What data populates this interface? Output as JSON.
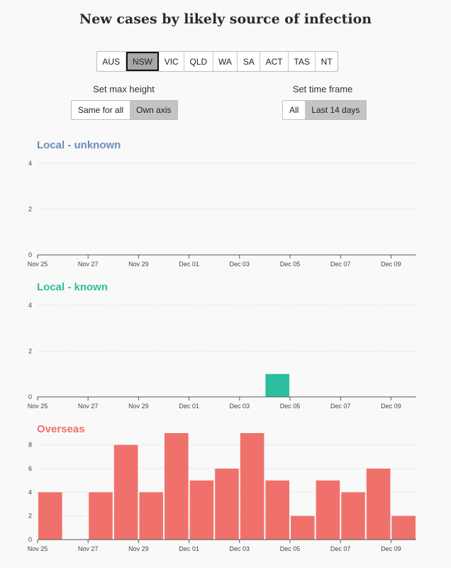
{
  "title": "New cases by likely source of infection",
  "states": [
    {
      "label": "AUS",
      "active": false
    },
    {
      "label": "NSW",
      "active": true
    },
    {
      "label": "VIC",
      "active": false
    },
    {
      "label": "QLD",
      "active": false
    },
    {
      "label": "WA",
      "active": false
    },
    {
      "label": "SA",
      "active": false
    },
    {
      "label": "ACT",
      "active": false
    },
    {
      "label": "TAS",
      "active": false
    },
    {
      "label": "NT",
      "active": false
    }
  ],
  "controls": {
    "max_height": {
      "label": "Set max height",
      "options": [
        "Same for all",
        "Own axis"
      ],
      "selected": "Own axis"
    },
    "time_frame": {
      "label": "Set time frame",
      "options": [
        "All",
        "Last 14 days"
      ],
      "selected": "Last 14 days"
    }
  },
  "colors": {
    "local_unknown": "#6b8db8",
    "local_known": "#2bbf9f",
    "overseas": "#f0716b"
  },
  "chart_data": [
    {
      "type": "bar",
      "title": "Local - unknown",
      "categories": [
        "Nov 25",
        "Nov 26",
        "Nov 27",
        "Nov 28",
        "Nov 29",
        "Nov 30",
        "Dec 01",
        "Dec 02",
        "Dec 03",
        "Dec 04",
        "Dec 05",
        "Dec 06",
        "Dec 07",
        "Dec 08",
        "Dec 09"
      ],
      "values": [
        0,
        0,
        0,
        0,
        0,
        0,
        0,
        0,
        0,
        0,
        0,
        0,
        0,
        0,
        0
      ],
      "ylim": [
        0,
        4
      ],
      "yticks": [
        0,
        2,
        4
      ],
      "xtick_labels": [
        "Nov 25",
        "Nov 27",
        "Nov 29",
        "Dec 01",
        "Dec 03",
        "Dec 05",
        "Dec 07",
        "Dec 09"
      ],
      "grid": true,
      "color": "#6b8db8"
    },
    {
      "type": "bar",
      "title": "Local - known",
      "categories": [
        "Nov 25",
        "Nov 26",
        "Nov 27",
        "Nov 28",
        "Nov 29",
        "Nov 30",
        "Dec 01",
        "Dec 02",
        "Dec 03",
        "Dec 04",
        "Dec 05",
        "Dec 06",
        "Dec 07",
        "Dec 08",
        "Dec 09"
      ],
      "values": [
        0,
        0,
        0,
        0,
        0,
        0,
        0,
        0,
        0,
        1,
        0,
        0,
        0,
        0,
        0
      ],
      "ylim": [
        0,
        4
      ],
      "yticks": [
        0,
        2,
        4
      ],
      "xtick_labels": [
        "Nov 25",
        "Nov 27",
        "Nov 29",
        "Dec 01",
        "Dec 03",
        "Dec 05",
        "Dec 07",
        "Dec 09"
      ],
      "grid": true,
      "color": "#2bbf9f"
    },
    {
      "type": "bar",
      "title": "Overseas",
      "categories": [
        "Nov 25",
        "Nov 26",
        "Nov 27",
        "Nov 28",
        "Nov 29",
        "Nov 30",
        "Dec 01",
        "Dec 02",
        "Dec 03",
        "Dec 04",
        "Dec 05",
        "Dec 06",
        "Dec 07",
        "Dec 08",
        "Dec 09"
      ],
      "values": [
        4,
        0,
        4,
        8,
        4,
        9,
        5,
        6,
        9,
        5,
        2,
        5,
        4,
        6,
        2
      ],
      "ylim": [
        0,
        9
      ],
      "yticks": [
        0,
        2,
        4,
        6,
        8
      ],
      "xtick_labels": [
        "Nov 25",
        "Nov 27",
        "Nov 29",
        "Dec 01",
        "Dec 03",
        "Dec 05",
        "Dec 07",
        "Dec 09"
      ],
      "grid": true,
      "color": "#f0716b"
    }
  ]
}
